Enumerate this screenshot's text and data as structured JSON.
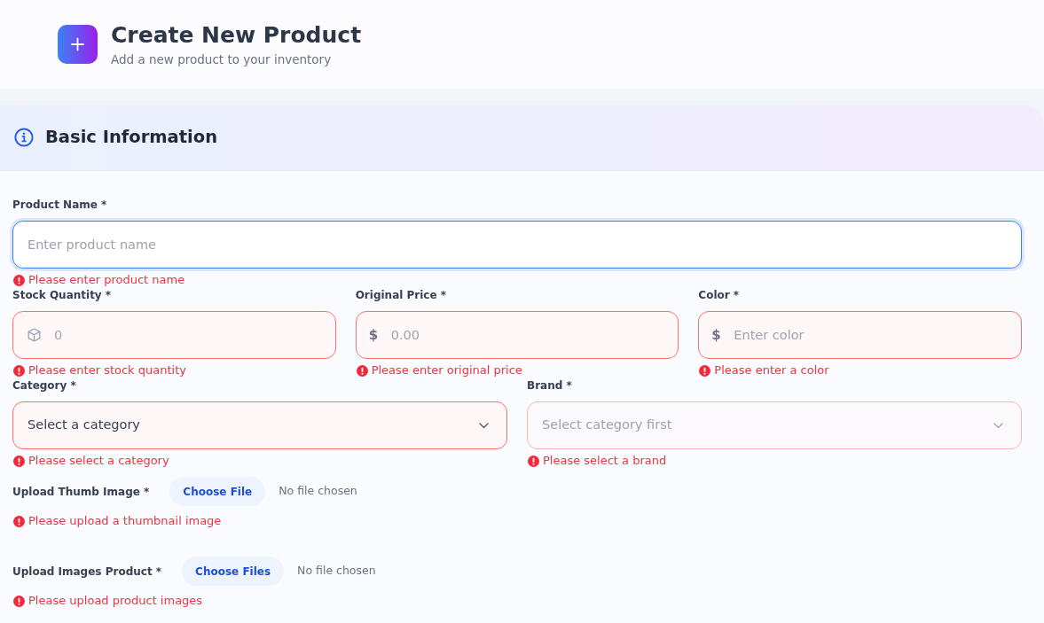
{
  "header": {
    "title": "Create New Product",
    "subtitle": "Add a new product to your inventory"
  },
  "section": {
    "title": "Basic Information",
    "rows": [
      {
        "fields": [
          {
            "kind": "text",
            "label": "Product Name *",
            "placeholder": "Enter product name",
            "focused": true,
            "invalid": true,
            "error": "Please enter product name"
          }
        ]
      },
      {
        "fields": [
          {
            "kind": "text",
            "label": "Stock Quantity *",
            "has_icon": true,
            "placeholder": "0",
            "focused": false,
            "invalid": true,
            "error": "Please enter stock quantity"
          },
          {
            "kind": "text",
            "label": "Original Price *",
            "prefix": "$",
            "placeholder": "0.00",
            "focused": false,
            "invalid": true,
            "error": "Please enter original price"
          },
          {
            "kind": "text",
            "label": "Color *",
            "prefix": "$",
            "placeholder": "Enter color",
            "focused": false,
            "invalid": true,
            "error": "Please enter a color"
          }
        ]
      },
      {
        "fields": [
          {
            "kind": "select",
            "label": "Category *",
            "value": "Select a category",
            "disabled": false,
            "invalid": true,
            "error": "Please select a category"
          },
          {
            "kind": "select",
            "label": "Brand *",
            "value": "Select category first",
            "disabled": true,
            "invalid": true,
            "error": "Please select a brand"
          }
        ]
      },
      {
        "fields": [
          {
            "kind": "file",
            "label": "Upload Thumb Image *",
            "button": "Choose File",
            "status": "No file chosen",
            "invalid": true,
            "error": "Please upload a thumbnail image"
          }
        ]
      },
      {
        "fields": [
          {
            "kind": "file",
            "label": "Upload Images Product *",
            "button": "Choose Files",
            "status": "No file chosen",
            "invalid": true,
            "error": "Please upload product images"
          }
        ]
      }
    ]
  }
}
